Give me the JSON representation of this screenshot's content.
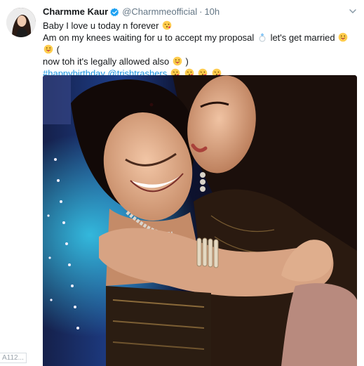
{
  "tweet": {
    "display_name": "Charmme Kaur",
    "handle": "@Charmmeofficial",
    "separator": "·",
    "time": "10h",
    "line1": "Baby I love u today n forever",
    "line2_a": "Am on my knees waiting for u to accept my proposal",
    "line2_b": "let's get married",
    "line2_c": "(",
    "line3_a": "now toh it's legally allowed also",
    "line3_b": ")",
    "hashtag": "#happybirthday",
    "mention": "@trishtrashers",
    "link_color": "#1b95e0"
  },
  "icons": {
    "verified": "verified-badge-icon",
    "chevron": "chevron-down-icon",
    "kiss": "face-blowing-kiss-emoji",
    "ring": "ring-emoji",
    "tongue": "face-with-tongue-emoji"
  },
  "watermark": "A112..."
}
